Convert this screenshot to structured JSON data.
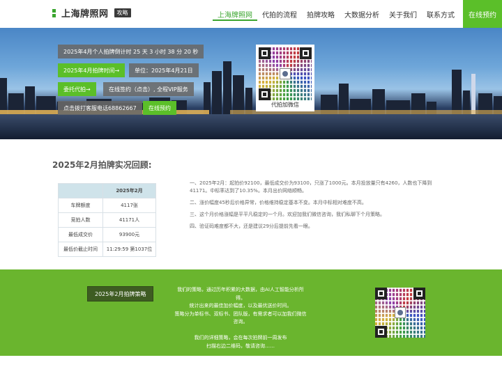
{
  "header": {
    "logo_text": "上海牌照网",
    "badge": "攻略",
    "nav": [
      "上海牌照网",
      "代拍的流程",
      "拍牌攻略",
      "大数据分析",
      "关于我们",
      "联系方式"
    ],
    "cta": "在线预约"
  },
  "banner": {
    "countdown": "2025年4月个人拍牌倒计时 25 天 3 小时 38 分 20 秒",
    "auction_time_btn": "2025年4月拍牌时间→",
    "auction_date": "单位：2025年4月21日",
    "bid_btn": "委托代拍→",
    "sign_vip": "在线签约（点击）, 全程VIP服务",
    "phone": "点击拨打客服电话68862667",
    "book_btn": "在线预约",
    "qr_caption": "代拍加微信"
  },
  "review": {
    "title": "2025年2月拍牌实况回顾:",
    "table_header": "2025年2月",
    "rows": [
      {
        "label": "车牌额度",
        "value": "4117张"
      },
      {
        "label": "竞拍人数",
        "value": "41171人"
      },
      {
        "label": "最低成交价",
        "value": "93900元"
      },
      {
        "label": "最低价截止时间",
        "value": "11:29:59 第1037位"
      }
    ],
    "notes": [
      "一、2025年2月：起拍价92100，最低成交价为93100，只涨了1000元。本月投放量只有4260，人数也下降到41171。中标率达到了10.35%。本月出价网络顺畅。",
      "二、涨价幅度45秒后价格异常，价格维持稳定基本不变。本月中标相对难度不高。",
      "三、这个月价格涨幅是平平凡稳定的一个月。欢迎加我们微信咨询，我们私聊下个月策略。",
      "四、验证码难度都不大，还是建议29分后提前先看一眼。"
    ]
  },
  "footer_band": {
    "strategy_btn": "2025年2月拍牌策略",
    "text_lines": [
      "我们的策略，通过历年积累的大数据，由AI人工智能分析所得。",
      "统计出来的最佳加价幅度，以及最优送价时间。",
      "策略分为单标书、双标书、团队版，有需求者可以加我们微信咨询。",
      "",
      "我们的详细策略，会在每次拍牌前一周发布",
      "扫描右边二维码，敬请咨询……"
    ]
  },
  "colors": {
    "accent": "#5bbf29",
    "dark_button": "#3e5c22",
    "band": "#6ab52e"
  },
  "icons": [
    "logo-mark-icon",
    "qr-code-icon"
  ]
}
